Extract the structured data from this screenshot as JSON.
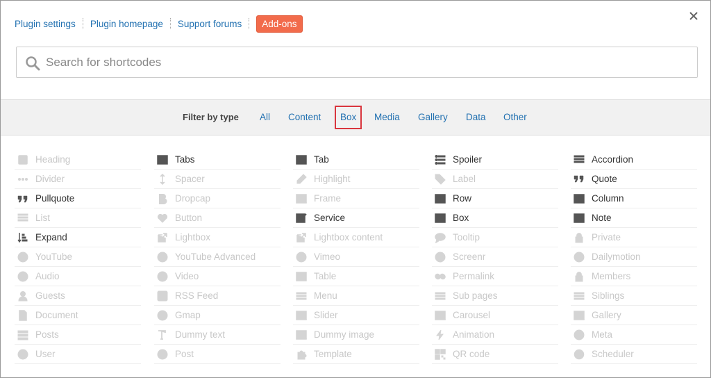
{
  "top_links": [
    "Plugin settings",
    "Plugin homepage",
    "Support forums"
  ],
  "addons_label": "Add-ons",
  "search": {
    "placeholder": "Search for shortcodes",
    "value": ""
  },
  "filter": {
    "label": "Filter by type",
    "items": [
      "All",
      "Content",
      "Box",
      "Media",
      "Gallery",
      "Data",
      "Other"
    ],
    "selected": "Box"
  },
  "columns": [
    [
      {
        "label": "Heading",
        "icon": "heading-icon",
        "active": false
      },
      {
        "label": "Divider",
        "icon": "ellipsis-icon",
        "active": false
      },
      {
        "label": "Pullquote",
        "icon": "quote-icon",
        "active": true
      },
      {
        "label": "List",
        "icon": "list-icon",
        "active": false
      },
      {
        "label": "Expand",
        "icon": "sort-icon",
        "active": true
      },
      {
        "label": "YouTube",
        "icon": "play-icon",
        "active": false
      },
      {
        "label": "Audio",
        "icon": "play-icon",
        "active": false
      },
      {
        "label": "Guests",
        "icon": "user-icon",
        "active": false
      },
      {
        "label": "Document",
        "icon": "document-icon",
        "active": false
      },
      {
        "label": "Posts",
        "icon": "th-list-icon",
        "active": false
      },
      {
        "label": "User",
        "icon": "info-icon",
        "active": false
      }
    ],
    [
      {
        "label": "Tabs",
        "icon": "list-alt-icon",
        "active": true
      },
      {
        "label": "Spacer",
        "icon": "height-icon",
        "active": false
      },
      {
        "label": "Dropcap",
        "icon": "bold-icon",
        "active": false
      },
      {
        "label": "Button",
        "icon": "heart-icon",
        "active": false
      },
      {
        "label": "Lightbox",
        "icon": "external-link-icon",
        "active": false
      },
      {
        "label": "YouTube Advanced",
        "icon": "play-icon",
        "active": false
      },
      {
        "label": "Video",
        "icon": "play-icon",
        "active": false
      },
      {
        "label": "RSS Feed",
        "icon": "rss-icon",
        "active": false
      },
      {
        "label": "Gmap",
        "icon": "globe-icon",
        "active": false
      },
      {
        "label": "Dummy text",
        "icon": "text-height-icon",
        "active": false
      },
      {
        "label": "Post",
        "icon": "info-icon",
        "active": false
      }
    ],
    [
      {
        "label": "Tab",
        "icon": "list-alt-icon",
        "active": true
      },
      {
        "label": "Highlight",
        "icon": "pencil-icon",
        "active": false
      },
      {
        "label": "Frame",
        "icon": "picture-icon",
        "active": false
      },
      {
        "label": "Service",
        "icon": "check-square-icon",
        "active": true
      },
      {
        "label": "Lightbox content",
        "icon": "external-link-icon",
        "active": false
      },
      {
        "label": "Vimeo",
        "icon": "play-icon",
        "active": false
      },
      {
        "label": "Table",
        "icon": "table-icon",
        "active": false
      },
      {
        "label": "Menu",
        "icon": "bars-icon",
        "active": false
      },
      {
        "label": "Slider",
        "icon": "picture-icon",
        "active": false
      },
      {
        "label": "Dummy image",
        "icon": "picture-icon",
        "active": false
      },
      {
        "label": "Template",
        "icon": "puzzle-icon",
        "active": false
      }
    ],
    [
      {
        "label": "Spoiler",
        "icon": "list-ul-icon",
        "active": true
      },
      {
        "label": "Label",
        "icon": "tag-icon",
        "active": false
      },
      {
        "label": "Row",
        "icon": "columns-icon",
        "active": true
      },
      {
        "label": "Box",
        "icon": "list-alt-icon",
        "active": true
      },
      {
        "label": "Tooltip",
        "icon": "comment-icon",
        "active": false
      },
      {
        "label": "Screenr",
        "icon": "play-icon",
        "active": false
      },
      {
        "label": "Permalink",
        "icon": "link-icon",
        "active": false
      },
      {
        "label": "Sub pages",
        "icon": "bars-icon",
        "active": false
      },
      {
        "label": "Carousel",
        "icon": "picture-icon",
        "active": false
      },
      {
        "label": "Animation",
        "icon": "bolt-icon",
        "active": false
      },
      {
        "label": "QR code",
        "icon": "qrcode-icon",
        "active": false
      }
    ],
    [
      {
        "label": "Accordion",
        "icon": "list-icon",
        "active": true
      },
      {
        "label": "Quote",
        "icon": "quote-right-icon",
        "active": true
      },
      {
        "label": "Column",
        "icon": "columns-icon",
        "active": true
      },
      {
        "label": "Note",
        "icon": "list-alt-icon",
        "active": true
      },
      {
        "label": "Private",
        "icon": "lock-icon",
        "active": false
      },
      {
        "label": "Dailymotion",
        "icon": "play-icon",
        "active": false
      },
      {
        "label": "Members",
        "icon": "lock-icon",
        "active": false
      },
      {
        "label": "Siblings",
        "icon": "bars-icon",
        "active": false
      },
      {
        "label": "Gallery",
        "icon": "picture-icon",
        "active": false
      },
      {
        "label": "Meta",
        "icon": "info-icon",
        "active": false
      },
      {
        "label": "Scheduler",
        "icon": "clock-icon",
        "active": false
      }
    ]
  ],
  "colors": {
    "link": "#2271b1",
    "addons": "#f26b4b",
    "selected_border": "#d9363e"
  }
}
